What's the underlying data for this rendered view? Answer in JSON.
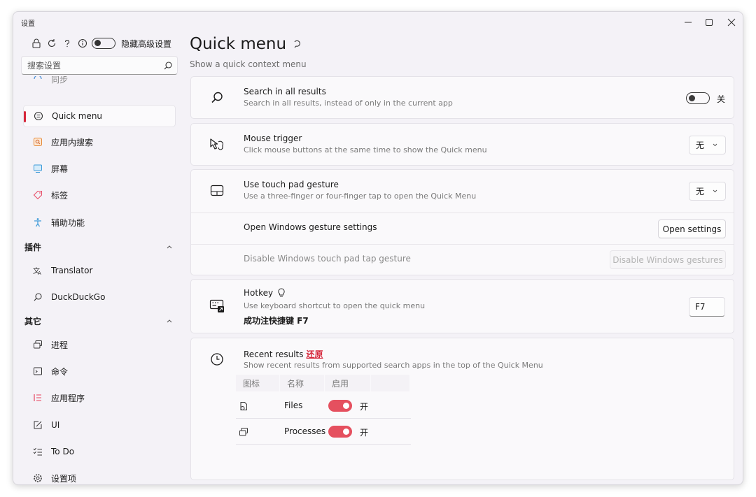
{
  "window": {
    "title": "设置"
  },
  "sidebar": {
    "hide_advanced_label": "隐藏高级设置",
    "search_placeholder": "搜索设置",
    "partial_item_label": "同步",
    "items": [
      {
        "label": "Quick menu",
        "icon": "circle-list-icon",
        "active": true
      },
      {
        "label": "应用内搜索",
        "icon": "in-app-search-icon"
      },
      {
        "label": "屏幕",
        "icon": "screen-icon"
      },
      {
        "label": "标签",
        "icon": "tag-icon"
      },
      {
        "label": "辅助功能",
        "icon": "accessibility-icon"
      }
    ],
    "groups": [
      {
        "label": "插件",
        "items": [
          {
            "label": "Translator",
            "icon": "translate-icon"
          },
          {
            "label": "DuckDuckGo",
            "icon": "search-icon"
          }
        ]
      },
      {
        "label": "其它",
        "items": [
          {
            "label": "进程",
            "icon": "processes-icon"
          },
          {
            "label": "命令",
            "icon": "command-icon"
          },
          {
            "label": "应用程序",
            "icon": "apps-icon"
          },
          {
            "label": "UI",
            "icon": "ui-icon"
          },
          {
            "label": "To Do",
            "icon": "todo-icon"
          },
          {
            "label": "设置项",
            "icon": "gear-icon"
          }
        ]
      }
    ]
  },
  "main": {
    "title": "Quick menu",
    "subtitle": "Show a quick context menu",
    "search_all": {
      "title": "Search in all results",
      "desc": "Search in all results, instead of only in the current app",
      "toggle_label": "关",
      "on": false
    },
    "mouse_trigger": {
      "title": "Mouse trigger",
      "desc": "Click mouse buttons at the same time to show the Quick menu",
      "value": "无"
    },
    "touchpad": {
      "title": "Use touch pad gesture",
      "desc": "Use a three-finger or four-finger tap to open the Quick Menu",
      "value": "无",
      "open_settings_label": "Open Windows gesture settings",
      "open_settings_button": "Open settings",
      "disable_label": "Disable Windows touch pad tap gesture",
      "disable_button": "Disable Windows gestures"
    },
    "hotkey": {
      "title": "Hotkey",
      "desc": "Use keyboard shortcut to open the quick menu",
      "status": "成功注快捷键 F7",
      "value": "F7"
    },
    "recent": {
      "title": "Recent results",
      "restore_label": "还原",
      "desc": "Show recent results from supported search apps in the top of the Quick Menu",
      "columns": [
        "图标",
        "名称",
        "启用"
      ],
      "rows": [
        {
          "name": "Files",
          "icon": "files-icon",
          "enabled_label": "开",
          "enabled": true
        },
        {
          "name": "Processes",
          "icon": "processes-icon",
          "enabled_label": "开",
          "enabled": true
        }
      ]
    }
  },
  "colors": {
    "accent": "#d6273b",
    "toggle_on": "#e5505f",
    "background": "#f4f2f7",
    "card": "#faf9fb"
  }
}
